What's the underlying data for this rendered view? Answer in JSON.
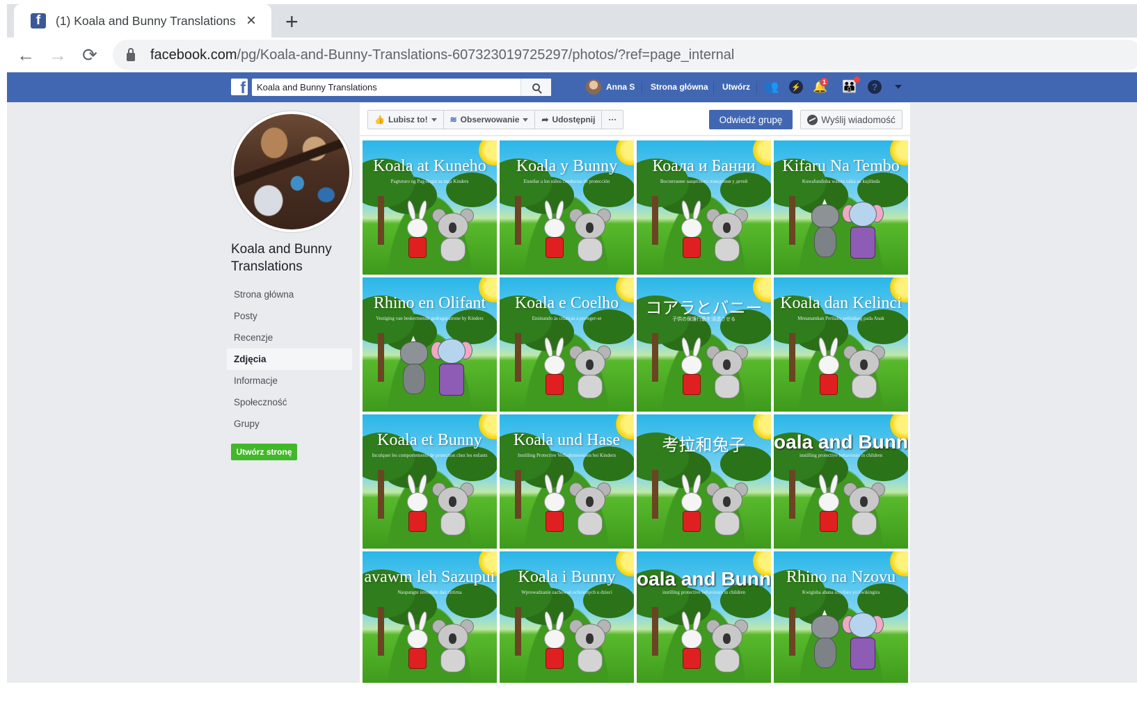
{
  "browser": {
    "tab_title": "(1) Koala and Bunny Translations",
    "tab_close": "×",
    "new_tab": "+",
    "url_host": "facebook.com",
    "url_path": "/pg/Koala-and-Bunny-Translations-607323019725297/photos/?ref=page_internal",
    "back": "←",
    "forward": "→",
    "reload": "⟳"
  },
  "fb": {
    "logo": "f",
    "search_value": "Koala and Bunny Translations",
    "user_name": "Anna S",
    "nav_home": "Strona główna",
    "nav_create": "Utwórz",
    "notification_count": "1",
    "brand_color": "#4267b2"
  },
  "page": {
    "name": "Koala and Bunny Translations",
    "side_nav": [
      "Strona główna",
      "Posty",
      "Recenzje",
      "Zdjęcia",
      "Informacje",
      "Społeczność",
      "Grupy"
    ],
    "active_item": "Zdjęcia",
    "create_page_button": "Utwórz stronę"
  },
  "actions": {
    "like": "Lubisz to!",
    "follow": "Obserwowanie",
    "share": "Udostępnij",
    "more": "···",
    "visit_group": "Odwiedź grupę",
    "send_message": "Wyślij wiadomość"
  },
  "photos": [
    {
      "title": "Koala at Kuneho",
      "subtitle": "Pagtuturo ng Pag-iingat sa mga Kinders",
      "kind": "koala"
    },
    {
      "title": "Koala y Bunny",
      "subtitle": "Enseñar a los niños conductas de protección",
      "kind": "koala"
    },
    {
      "title": "Коала и Банни",
      "subtitle": "Воспитание защитного поведения у детей",
      "kind": "koala"
    },
    {
      "title": "Kifaru Na Tembo",
      "subtitle": "Kuwafundisha watoto tabia za kujilinda",
      "kind": "rhino"
    },
    {
      "title": "Rhino en Olifant",
      "subtitle": "Vestiging van beskermende gedragspatrone by Kinders",
      "kind": "rhino"
    },
    {
      "title": "Koala e Coelho",
      "subtitle": "Ensinando às crianças a proteger-se",
      "kind": "koala"
    },
    {
      "title": "コアラとバニー",
      "subtitle": "子供の保護行動を浸透させる",
      "kind": "koala"
    },
    {
      "title": "Koala dan Kelinci",
      "subtitle": "Menanamkan Perilaku pelindung pada Anak",
      "kind": "koala"
    },
    {
      "title": "Koala et Bunny",
      "subtitle": "Inculquer les comportements de protection chez les enfants",
      "kind": "koala"
    },
    {
      "title": "Koala und Hase",
      "subtitle": "Instilling Protective Verhaltensweisen bei Kindern",
      "kind": "koala"
    },
    {
      "title": "考拉和兔子",
      "subtitle": "",
      "kind": "koala"
    },
    {
      "title": "oala and Bunn",
      "subtitle": "instilling protective behaviours in children",
      "kind": "koala_bold"
    },
    {
      "title": "avawm leh Sazupui",
      "subtitle": "Naupangte invenhim dan zirtirna",
      "kind": "koala"
    },
    {
      "title": "Koala i Bunny",
      "subtitle": "Wprowadzanie zachowań ochronnych u dzieci",
      "kind": "koala"
    },
    {
      "title": "oala and Bunn",
      "subtitle": "instilling protective behaviours in children",
      "kind": "koala_bold"
    },
    {
      "title": "Rhino na Nzovu",
      "subtitle": "Kwigisha abana imyifato yo kwikingira",
      "kind": "rhino"
    }
  ]
}
